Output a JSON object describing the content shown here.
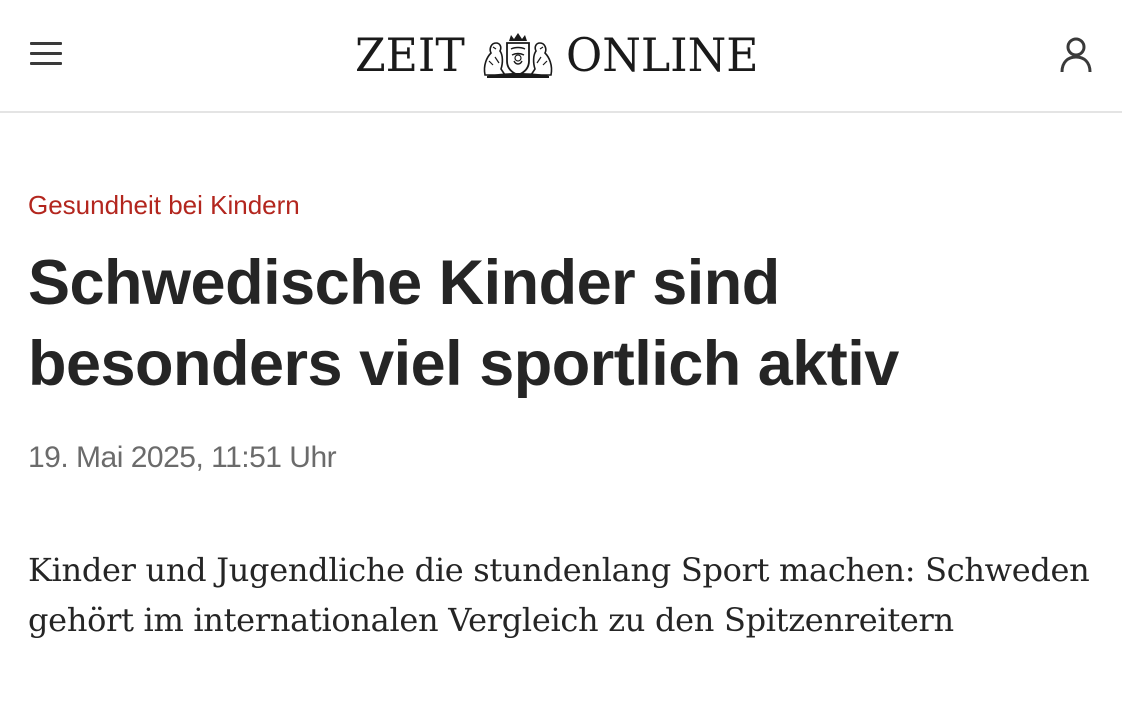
{
  "header": {
    "logo_left": "ZEIT",
    "logo_right": "ONLINE",
    "menu_icon": "hamburger-menu-icon",
    "user_icon": "user-account-icon"
  },
  "article": {
    "kicker": "Gesundheit bei Kindern",
    "headline": "Schwedische Kinder sind besonders viel sportlich aktiv",
    "date": "19. Mai 2025, 11:51 Uhr",
    "summary": "Kinder und Jugendliche die stundenlang Sport machen: Schweden gehört im internationalen Vergleich zu den Spitzenreitern"
  },
  "colors": {
    "kicker": "#b3261e",
    "text": "#252525",
    "meta": "#6b6b6b",
    "divider": "#e4e4e4"
  }
}
